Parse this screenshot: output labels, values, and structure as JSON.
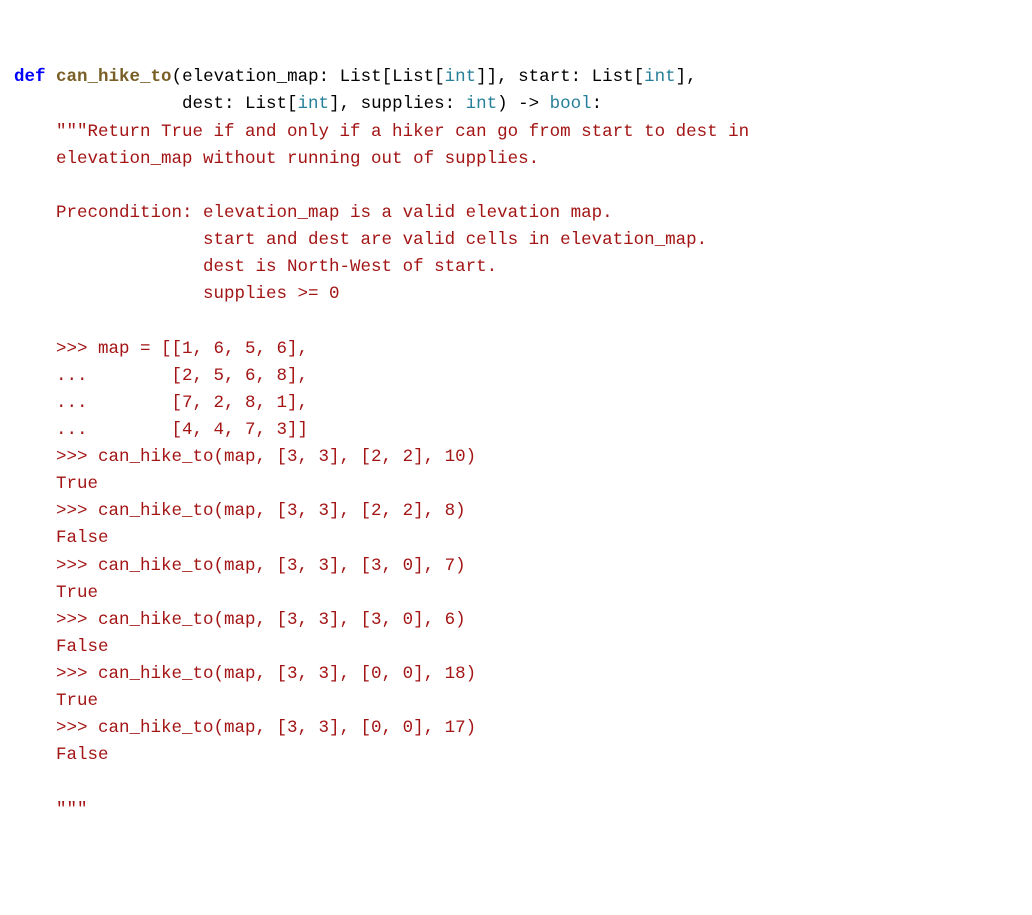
{
  "code": {
    "def_kw": "def",
    "fn_name": "can_hike_to",
    "sig_line1_a": "(elevation_map: List[List[",
    "sig_line1_b": "]], start: List[",
    "sig_line1_c": "],",
    "sig_line2_indent": "                dest: List[",
    "sig_line2_b": "], supplies: ",
    "sig_line2_c": ") -> ",
    "sig_line2_d": ":",
    "type_int": "int",
    "type_bool": "bool",
    "doc_open": "    \"\"\"Return True if and only if a hiker can go from start to dest in",
    "doc_l2": "    elevation_map without running out of supplies.",
    "doc_blank": "",
    "doc_l4": "    Precondition: elevation_map is a valid elevation map.",
    "doc_l5": "                  start and dest are valid cells in elevation_map.",
    "doc_l6": "                  dest is North-West of start.",
    "doc_l7": "                  supplies >= 0",
    "doc_l9": "    >>> map = [[1, 6, 5, 6],",
    "doc_l10": "    ...        [2, 5, 6, 8],",
    "doc_l11": "    ...        [7, 2, 8, 1],",
    "doc_l12": "    ...        [4, 4, 7, 3]]",
    "doc_l13": "    >>> can_hike_to(map, [3, 3], [2, 2], 10)",
    "doc_l14": "    True",
    "doc_l15": "    >>> can_hike_to(map, [3, 3], [2, 2], 8)",
    "doc_l16": "    False",
    "doc_l17": "    >>> can_hike_to(map, [3, 3], [3, 0], 7)",
    "doc_l18": "    True",
    "doc_l19": "    >>> can_hike_to(map, [3, 3], [3, 0], 6)",
    "doc_l20": "    False",
    "doc_l21": "    >>> can_hike_to(map, [3, 3], [0, 0], 18)",
    "doc_l22": "    True",
    "doc_l23": "    >>> can_hike_to(map, [3, 3], [0, 0], 17)",
    "doc_l24": "    False",
    "doc_close": "    \"\"\""
  }
}
